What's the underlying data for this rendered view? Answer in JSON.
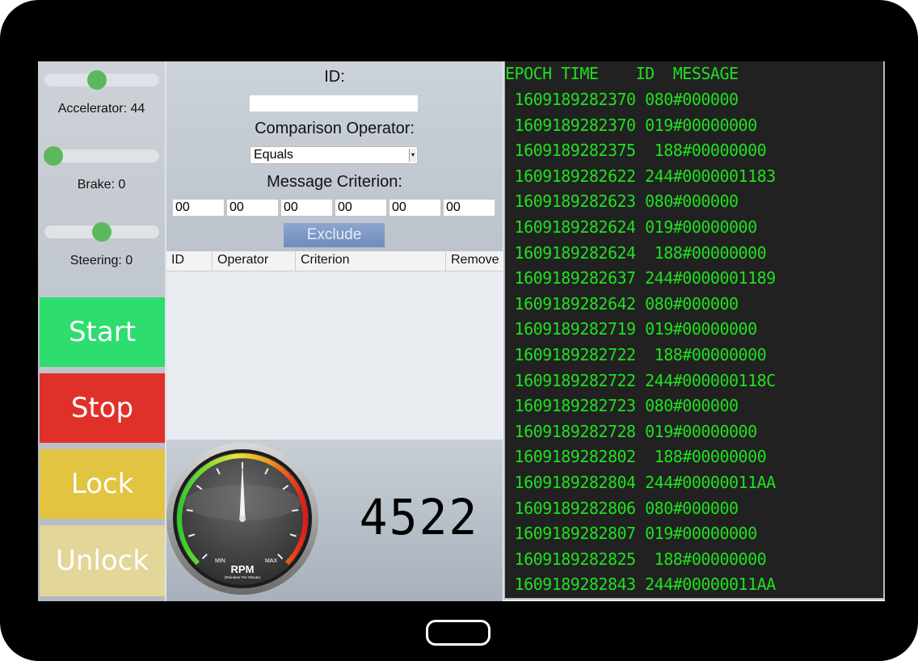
{
  "controls": {
    "accelerator": {
      "label": "Accelerator: 44",
      "value": 44,
      "fraction": 0.46
    },
    "brake": {
      "label": "Brake: 0",
      "value": 0,
      "fraction": 0.08
    },
    "steering": {
      "label": "Steering: 0",
      "value": 0,
      "fraction": 0.5
    }
  },
  "buttons": {
    "start": "Start",
    "stop": "Stop",
    "lock": "Lock",
    "unlock": "Unlock"
  },
  "colors": {
    "start": "#2ddd6e",
    "stop": "#e0302a",
    "lock": "#e2c440",
    "unlock": "#e2d698",
    "log_text": "#1fe01f",
    "log_bg": "#212121"
  },
  "filter": {
    "id_label": "ID:",
    "id_value": "",
    "operator_label": "Comparison Operator:",
    "operator_value": "Equals",
    "criterion_label": "Message Criterion:",
    "criterion_values": [
      "00",
      "00",
      "00",
      "00",
      "00",
      "00"
    ],
    "exclude_label": "Exclude"
  },
  "table": {
    "columns": [
      "ID",
      "Operator",
      "Criterion",
      "Remove"
    ],
    "rows": []
  },
  "gauge": {
    "label": "RPM",
    "sublabel": "(Reindeer Per Minute)",
    "min_label": "MIN",
    "max_label": "MAX",
    "value_fraction": 0.5
  },
  "rpm_display": "4522",
  "log": {
    "header": "EPOCH TIME    ID  MESSAGE",
    "rows": [
      " 1609189282370 080#000000",
      " 1609189282370 019#00000000",
      " 1609189282375  188#00000000",
      " 1609189282622 244#0000001183",
      " 1609189282623 080#000000",
      " 1609189282624 019#00000000",
      " 1609189282624  188#00000000",
      " 1609189282637 244#0000001189",
      " 1609189282642 080#000000",
      " 1609189282719 019#00000000",
      " 1609189282722  188#00000000",
      " 1609189282722 244#000000118C",
      " 1609189282723 080#000000",
      " 1609189282728 019#00000000",
      " 1609189282802  188#00000000",
      " 1609189282804 244#00000011AA",
      " 1609189282806 080#000000",
      " 1609189282807 019#00000000",
      " 1609189282825  188#00000000",
      " 1609189282843 244#00000011AA"
    ]
  }
}
